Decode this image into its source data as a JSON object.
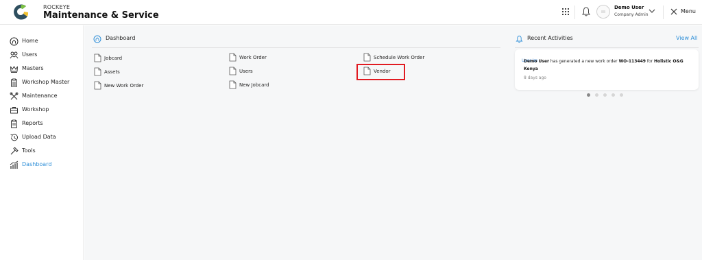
{
  "header": {
    "brand_small": "ROCKEYE",
    "brand_title": "Maintenance & Service",
    "user_name": "Demo User",
    "user_role": "Company Admin",
    "menu_label": "Menu"
  },
  "sidebar": {
    "items": [
      {
        "label": "Home",
        "icon": "home-icon"
      },
      {
        "label": "Users",
        "icon": "users-icon"
      },
      {
        "label": "Masters",
        "icon": "crown-icon"
      },
      {
        "label": "Workshop Master",
        "icon": "clipboard-icon"
      },
      {
        "label": "Maintenance",
        "icon": "wrench-icon"
      },
      {
        "label": "Workshop",
        "icon": "toolbox-icon"
      },
      {
        "label": "Reports",
        "icon": "report-icon"
      },
      {
        "label": "Upload Data",
        "icon": "history-icon"
      },
      {
        "label": "Tools",
        "icon": "hammer-icon"
      },
      {
        "label": "Dashboard",
        "icon": "dashboard-chart-icon",
        "active": true
      }
    ]
  },
  "dashboard": {
    "title": "Dashboard",
    "links": [
      "Jobcard",
      "Work Order",
      "Schedule Work Order",
      "Assets",
      "Users",
      "Vendor",
      "New Work Order",
      "New Jobcard"
    ]
  },
  "recent": {
    "title": "Recent Activities",
    "view_all": "View All",
    "img_alt": "User Im",
    "user": "Demo User",
    "text_mid": "has generated a new work order",
    "order": "WO-113449",
    "text_for": "for",
    "company": "Holistic O&G Kenya",
    "time": "8 days ago"
  },
  "colors": {
    "accent": "#2f8fd8",
    "highlight": "#e11b22",
    "logo_green": "#7cc242",
    "logo_dark": "#2f4f5f"
  }
}
